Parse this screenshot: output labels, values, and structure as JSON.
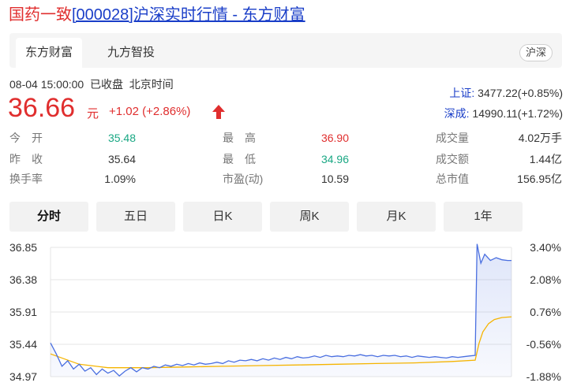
{
  "title": {
    "prefix": "国药一致",
    "code": "[000028]沪深实时行情 - 东方财富"
  },
  "tabs": [
    {
      "label": "东方财富"
    },
    {
      "label": "九方智投"
    }
  ],
  "market_badge": "沪深",
  "status_line": "08-04 15:00:00  已收盘  北京时间",
  "quote": {
    "price": "36.66",
    "unit": "元",
    "change": "+1.02 (+2.86%)",
    "direction": "up"
  },
  "indices": [
    {
      "name": "上证:",
      "value": " 3477.22(+0.85%)"
    },
    {
      "name": "深成:",
      "value": " 14990.11(+1.72%)"
    }
  ],
  "stats": [
    {
      "label": "今　开",
      "value": "35.48",
      "color": "#1aa884"
    },
    {
      "label": "昨　收",
      "value": "35.64",
      "color": "#333333"
    },
    {
      "label": "换手率",
      "value": "1.09%",
      "color": "#333333"
    },
    {
      "label": "最　高",
      "value": "36.90",
      "color": "#e02e2e"
    },
    {
      "label": "最　低",
      "value": "34.96",
      "color": "#1aa884"
    },
    {
      "label": "市盈(动)",
      "value": "10.59",
      "color": "#333333"
    },
    {
      "label": "成交量",
      "value": "4.02万手",
      "color": "#333333"
    },
    {
      "label": "成交额",
      "value": "1.44亿",
      "color": "#333333"
    },
    {
      "label": "总市值",
      "value": "156.95亿",
      "color": "#333333"
    }
  ],
  "periods": [
    {
      "label": "分时"
    },
    {
      "label": "五日"
    },
    {
      "label": "日K"
    },
    {
      "label": "周K"
    },
    {
      "label": "月K"
    },
    {
      "label": "1年"
    }
  ],
  "colors": {
    "up": "#e02e2e",
    "down": "#1aa884",
    "link": "#1a3ec8",
    "price_line": "#4a6fe0",
    "avg_line": "#f5b400"
  },
  "chart_data": {
    "type": "line",
    "y_left_ticks": [
      "36.85",
      "36.38",
      "35.91",
      "35.44",
      "34.97"
    ],
    "y_right_ticks": [
      "3.40%",
      "2.08%",
      "0.76%",
      "-0.56%",
      "-1.88%"
    ],
    "ylim": [
      34.97,
      36.85
    ],
    "x_index_range": [
      0,
      241
    ],
    "series": [
      {
        "role": "price",
        "points": [
          [
            0,
            35.46
          ],
          [
            3,
            35.3
          ],
          [
            6,
            35.12
          ],
          [
            9,
            35.2
          ],
          [
            12,
            35.08
          ],
          [
            15,
            35.15
          ],
          [
            18,
            35.05
          ],
          [
            21,
            35.1
          ],
          [
            24,
            35.0
          ],
          [
            27,
            35.08
          ],
          [
            30,
            35.02
          ],
          [
            33,
            35.06
          ],
          [
            36,
            34.98
          ],
          [
            39,
            35.05
          ],
          [
            42,
            35.1
          ],
          [
            45,
            35.04
          ],
          [
            48,
            35.1
          ],
          [
            51,
            35.08
          ],
          [
            54,
            35.12
          ],
          [
            57,
            35.1
          ],
          [
            60,
            35.14
          ],
          [
            63,
            35.12
          ],
          [
            66,
            35.15
          ],
          [
            69,
            35.13
          ],
          [
            72,
            35.16
          ],
          [
            75,
            35.14
          ],
          [
            78,
            35.17
          ],
          [
            81,
            35.15
          ],
          [
            84,
            35.16
          ],
          [
            87,
            35.18
          ],
          [
            90,
            35.16
          ],
          [
            93,
            35.2
          ],
          [
            96,
            35.18
          ],
          [
            99,
            35.21
          ],
          [
            102,
            35.2
          ],
          [
            105,
            35.22
          ],
          [
            108,
            35.2
          ],
          [
            111,
            35.23
          ],
          [
            114,
            35.21
          ],
          [
            117,
            35.24
          ],
          [
            120,
            35.22
          ],
          [
            123,
            35.25
          ],
          [
            126,
            35.23
          ],
          [
            129,
            35.26
          ],
          [
            132,
            35.24
          ],
          [
            135,
            35.25
          ],
          [
            138,
            35.27
          ],
          [
            141,
            35.25
          ],
          [
            144,
            35.28
          ],
          [
            147,
            35.26
          ],
          [
            150,
            35.27
          ],
          [
            153,
            35.26
          ],
          [
            156,
            35.28
          ],
          [
            159,
            35.27
          ],
          [
            162,
            35.29
          ],
          [
            165,
            35.27
          ],
          [
            168,
            35.28
          ],
          [
            171,
            35.26
          ],
          [
            174,
            35.28
          ],
          [
            177,
            35.27
          ],
          [
            180,
            35.28
          ],
          [
            183,
            35.26
          ],
          [
            186,
            35.27
          ],
          [
            189,
            35.25
          ],
          [
            192,
            35.27
          ],
          [
            195,
            35.26
          ],
          [
            198,
            35.25
          ],
          [
            201,
            35.26
          ],
          [
            204,
            35.25
          ],
          [
            207,
            35.24
          ],
          [
            210,
            35.26
          ],
          [
            213,
            35.25
          ],
          [
            216,
            35.26
          ],
          [
            219,
            35.27
          ],
          [
            222,
            35.28
          ],
          [
            223,
            36.9
          ],
          [
            225,
            36.62
          ],
          [
            227,
            36.75
          ],
          [
            230,
            36.66
          ],
          [
            233,
            36.7
          ],
          [
            236,
            36.67
          ],
          [
            239,
            36.66
          ],
          [
            241,
            36.66
          ]
        ]
      },
      {
        "role": "average",
        "points": [
          [
            0,
            35.3
          ],
          [
            15,
            35.15
          ],
          [
            30,
            35.1
          ],
          [
            50,
            35.1
          ],
          [
            70,
            35.11
          ],
          [
            90,
            35.12
          ],
          [
            110,
            35.13
          ],
          [
            130,
            35.14
          ],
          [
            150,
            35.15
          ],
          [
            170,
            35.16
          ],
          [
            190,
            35.17
          ],
          [
            210,
            35.19
          ],
          [
            222,
            35.21
          ],
          [
            224,
            35.45
          ],
          [
            226,
            35.62
          ],
          [
            229,
            35.74
          ],
          [
            232,
            35.8
          ],
          [
            236,
            35.83
          ],
          [
            241,
            35.84
          ]
        ]
      }
    ]
  }
}
